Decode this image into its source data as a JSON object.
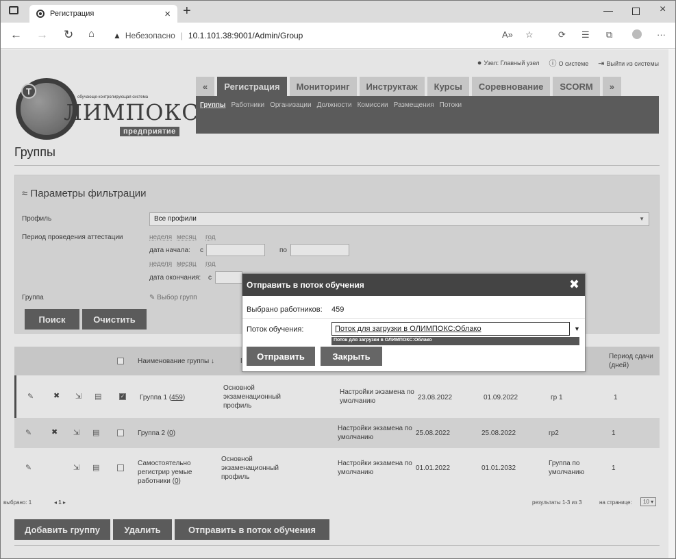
{
  "browser": {
    "tab_title": "Регистрация",
    "security": "Небезопасно",
    "url": "10.1.101.38:9001/Admin/Group"
  },
  "topbar": {
    "node": "Узел: Главный узел",
    "about": "О системе",
    "logout": "Выйти из системы"
  },
  "logo": {
    "subtitle": "обучающе-контролирующая система",
    "name": "ЛИМПОКС",
    "edition": "предприятие"
  },
  "nav": {
    "tabs": [
      "«",
      "Регистрация",
      "Мониторинг",
      "Инструктаж",
      "Курсы",
      "Соревнование",
      "SCORM",
      "»"
    ],
    "sub": [
      "Группы",
      "Работники",
      "Организации",
      "Должности",
      "Комиссии",
      "Размещения",
      "Потоки"
    ]
  },
  "page_title": "Группы",
  "filter": {
    "header": "Параметры фильтрации",
    "profile_label": "Профиль",
    "profile_value": "Все профили",
    "period_label": "Период проведения аттестации",
    "week": "неделя",
    "month": "месяц",
    "year": "год",
    "start_label": "дата начала:",
    "from": "с",
    "to": "по",
    "end_label": "дата окончания:",
    "group_label": "Группа",
    "group_pick": "Выбор групп",
    "search": "Поиск",
    "clear": "Очистить"
  },
  "table": {
    "col_name": "Наименование группы ↓",
    "col_g": "Г",
    "col_period": "Период сдачи (дней)",
    "rows": [
      {
        "checked": true,
        "name": "Группа 1 (",
        "count": "459",
        "profile": "Основной экзаменационный профиль",
        "settings": "Настройки экзамена по умолчанию",
        "d1": "23.08.2022",
        "d2": "01.09.2022",
        "grp": "гр 1",
        "days": "1",
        "del": true
      },
      {
        "checked": false,
        "name": "Группа 2 (",
        "count": "0",
        "profile": "",
        "settings": "Настройки экзамена по умолчанию",
        "d1": "25.08.2022",
        "d2": "25.08.2022",
        "grp": "гр2",
        "days": "1",
        "del": true
      },
      {
        "checked": false,
        "name": "Самостоятельно регистрир уемые работники (",
        "count": "0",
        "profile": "Основной экзаменационный профиль",
        "settings": "Настройки экзамена по умолчанию",
        "d1": "01.01.2022",
        "d2": "01.01.2032",
        "grp": "Группа по умолчанию",
        "days": "1",
        "del": false
      }
    ]
  },
  "pager": {
    "selected": "выбрано: 1",
    "page": "1",
    "results": "результаты 1-3 из 3",
    "per_page_label": "на странице:",
    "per_page": "10"
  },
  "actions": {
    "add": "Добавить группу",
    "delete": "Удалить",
    "send": "Отправить в поток обучения"
  },
  "modal": {
    "title": "Отправить в поток обучения",
    "selected_label": "Выбрано работников:",
    "selected_value": "459",
    "stream_label": "Поток обучения:",
    "stream_value": "Поток для загрузки в ОЛИМПОКС:Облако",
    "option": "Поток для загрузки в ОЛИМПОКС:Облако",
    "send": "Отправить",
    "close": "Закрыть"
  }
}
